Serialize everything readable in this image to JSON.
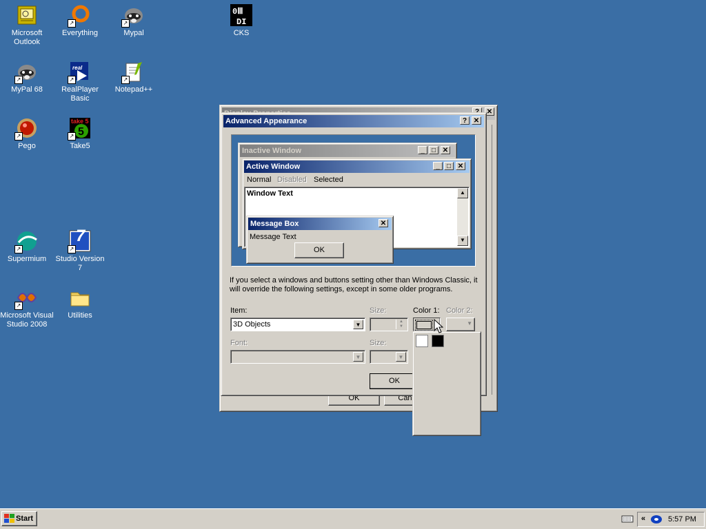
{
  "desktop": {
    "icons": [
      {
        "label": "Microsoft Outlook",
        "icon": "outlook-icon"
      },
      {
        "label": "Everything",
        "icon": "everything-icon"
      },
      {
        "label": "Mypal",
        "icon": "mypal-icon"
      },
      {
        "label": "CKS",
        "icon": "cks-icon"
      },
      {
        "label": "MyPal 68",
        "icon": "mypal68-icon"
      },
      {
        "label": "RealPlayer Basic",
        "icon": "realplayer-icon",
        "badge": "real"
      },
      {
        "label": "Notepad++",
        "icon": "notepadpp-icon"
      },
      {
        "label": "Pego",
        "icon": "pego-icon"
      },
      {
        "label": "Take5",
        "icon": "take5-icon",
        "badge": "take 5"
      },
      {
        "label": "Supermium",
        "icon": "supermium-icon"
      },
      {
        "label": "Studio Version 7",
        "icon": "studio7-icon",
        "badge": "7"
      },
      {
        "label": "Microsoft Visual Studio 2008",
        "icon": "vs2008-icon"
      },
      {
        "label": "Utilities",
        "icon": "folder-icon"
      }
    ]
  },
  "bg_window": {
    "title": "Display Properties",
    "ok_label": "OK",
    "cancel_label": "Cancel"
  },
  "dialog": {
    "title": "Advanced Appearance",
    "help_btn": "?",
    "close_btn": "✕",
    "preview": {
      "inactive_title": "Inactive Window",
      "active_title": "Active Window",
      "menu_normal": "Normal",
      "menu_disabled": "Disabled",
      "menu_selected": "Selected",
      "window_text": "Window Text",
      "msgbox_title": "Message Box",
      "msgbox_text": "Message Text",
      "msgbox_ok": "OK"
    },
    "info_text": "If you select a windows and buttons setting other than Windows Classic, it will override the following settings, except in some older programs.",
    "item_label": "Item:",
    "item_value": "3D Objects",
    "size_label": "Size:",
    "color1_label": "Color 1:",
    "color2_label": "Color 2:",
    "font_label": "Font:",
    "font_size_label": "Size:",
    "ok_label": "OK",
    "colors": {
      "selected": "#d4d0c8",
      "white": "#ffffff",
      "black": "#000000"
    }
  },
  "taskbar": {
    "start_label": "Start",
    "tray_chevron": "«",
    "time": "5:57 PM"
  }
}
